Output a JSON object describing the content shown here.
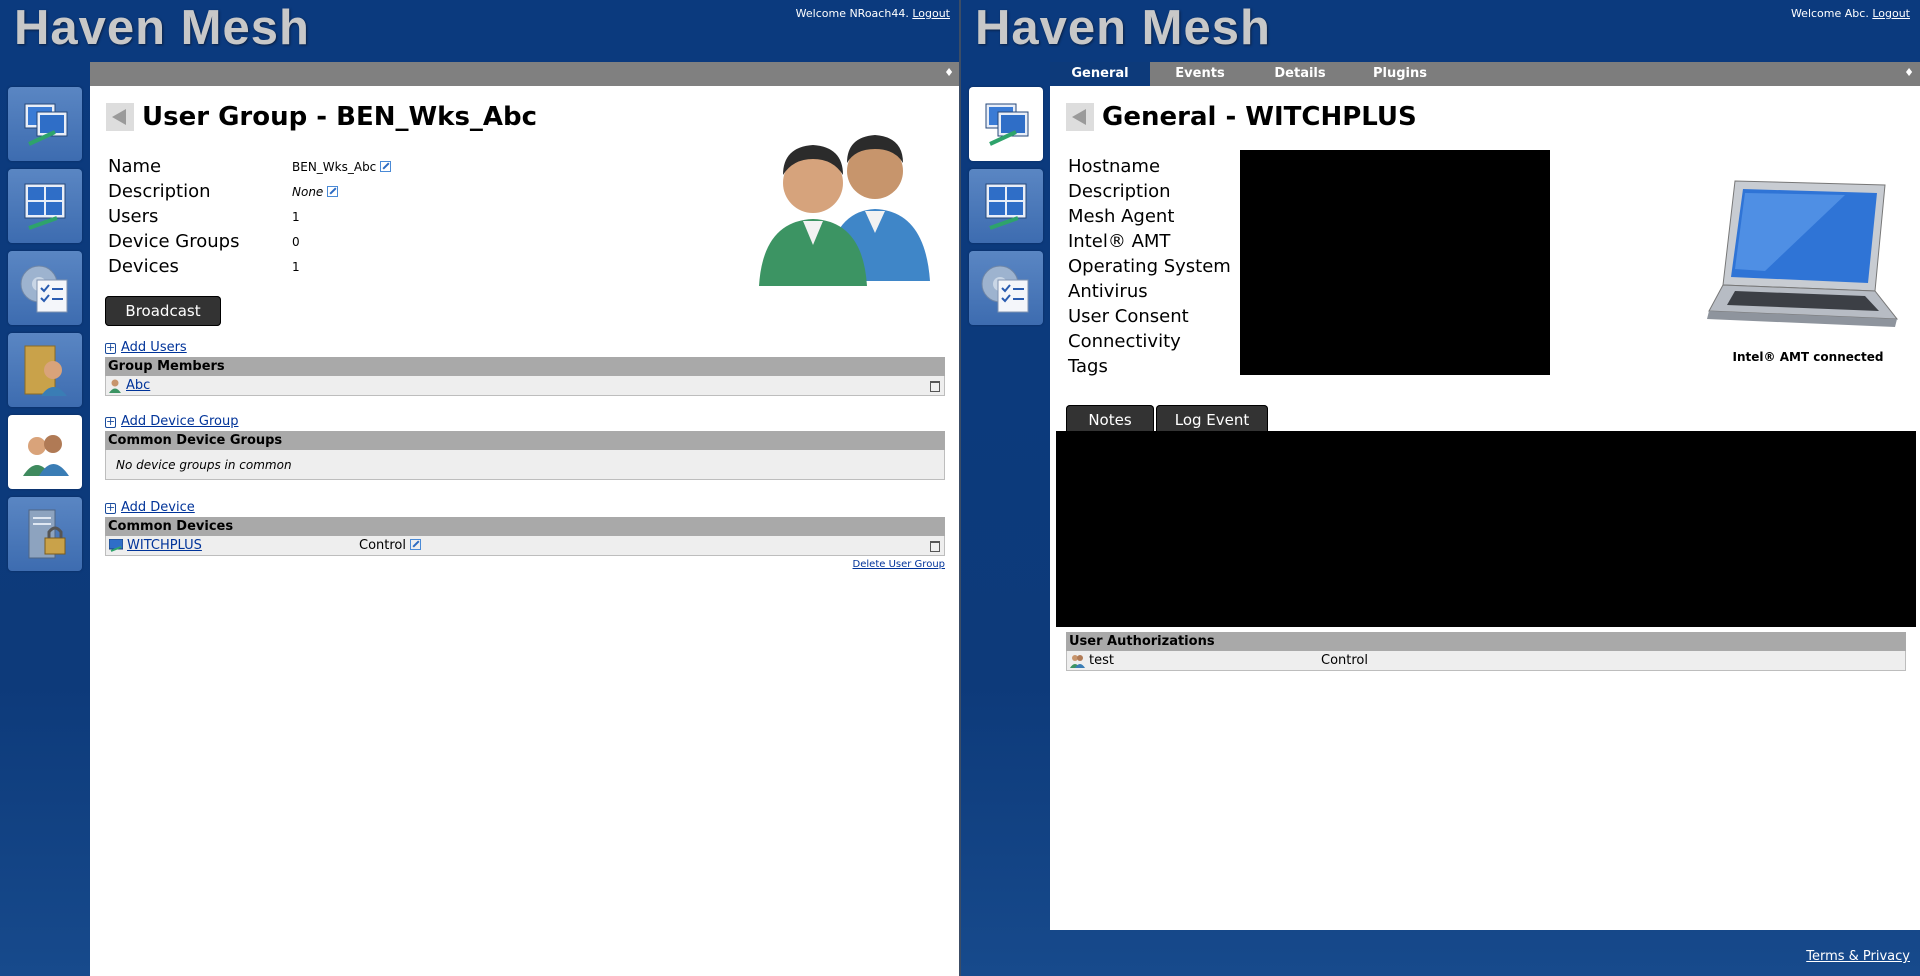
{
  "left": {
    "brand": "Haven Mesh",
    "welcome_text": "Welcome NRoach44.",
    "logout": "Logout",
    "title": "User Group - BEN_Wks_Abc",
    "properties": [
      {
        "label": "Name",
        "value": "BEN_Wks_Abc"
      },
      {
        "label": "Description",
        "value": "None"
      },
      {
        "label": "Users",
        "value": "1"
      },
      {
        "label": "Device Groups",
        "value": "0"
      },
      {
        "label": "Devices",
        "value": "1"
      }
    ],
    "broadcast_button": "Broadcast",
    "add_users": "Add Users",
    "group_members_header": "Group Members",
    "member_name": "Abc",
    "add_device_group": "Add Device Group",
    "common_device_groups_header": "Common Device Groups",
    "no_device_groups": "No device groups in common",
    "add_device": "Add Device",
    "common_devices_header": "Common Devices",
    "device_name": "WITCHPLUS",
    "device_rights": "Control",
    "delete_user_group": "Delete User Group",
    "pin_glyph": "♦"
  },
  "right": {
    "brand": "Haven Mesh",
    "welcome_text": "Welcome Abc.",
    "logout": "Logout",
    "tabs": [
      "General",
      "Events",
      "Details",
      "Plugins"
    ],
    "active_tab": "General",
    "title": "General - WITCHPLUS",
    "properties": [
      "Hostname",
      "Description",
      "Mesh Agent",
      "Intel® AMT",
      "Operating System",
      "Antivirus",
      "User Consent",
      "Connectivity",
      "Tags"
    ],
    "amt_status": "Intel® AMT connected",
    "notes_button": "Notes",
    "log_event_button": "Log Event",
    "user_auth_header": "User Authorizations",
    "auth_user": "test",
    "auth_rights": "Control",
    "terms": "Terms & Privacy",
    "pin_glyph": "♦"
  },
  "colors": {
    "brand_text": "#c8c8c8",
    "background": "#0b3a7e",
    "sidebar_button": "#4a78b8",
    "link": "#003399"
  }
}
